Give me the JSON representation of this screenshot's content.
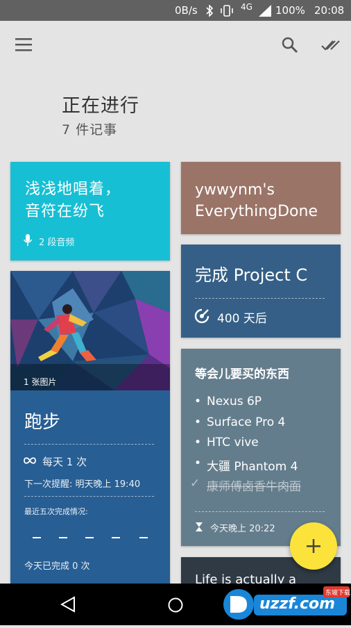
{
  "status_bar": {
    "speed": "0B/s",
    "network": "4G",
    "battery": "100%",
    "time": "20:08"
  },
  "app_bar": {
    "menu_icon": "menu-icon",
    "search_icon": "search-icon",
    "done_icon": "double-check-icon"
  },
  "header": {
    "title": "正在进行",
    "subtitle": "7 件记事"
  },
  "cards": {
    "audio": {
      "text": "浅浅地唱着，\n音符在纷飞",
      "meta": "2 段音频",
      "color": "#17bfd4"
    },
    "run": {
      "image_caption": "1 张图片",
      "title": "跑步",
      "repeat": "每天 1 次",
      "next_reminder": "下一次提醒: 明天晚上 19:40",
      "recent_label": "最近五次完成情况:",
      "today_done": "今天已完成 0 次",
      "color": "#275e94"
    },
    "ywwynm": {
      "text": "ywwynm's\nEverythingDone",
      "color": "#9b7468"
    },
    "project": {
      "title": "完成 Project C",
      "countdown": "400 天后",
      "color": "#355f86"
    },
    "shopping": {
      "title": "等会儿要买的东西",
      "items": [
        {
          "text": "Nexus 6P",
          "done": false
        },
        {
          "text": "Surface Pro 4",
          "done": false
        },
        {
          "text": "HTC vive",
          "done": false
        },
        {
          "text": "大疆 Phantom 4",
          "done": false
        },
        {
          "text": "康师傅卤香牛肉面",
          "done": true
        }
      ],
      "reminder": "今天晚上 20:22",
      "color": "#647d8c"
    },
    "life": {
      "text": "Life is actually a",
      "color": "#2f3a45"
    }
  },
  "fab": {
    "icon": "plus-icon",
    "color": "#fbe33b"
  },
  "watermark": {
    "brand": "uzzf.com",
    "tag": "东坡下载"
  }
}
